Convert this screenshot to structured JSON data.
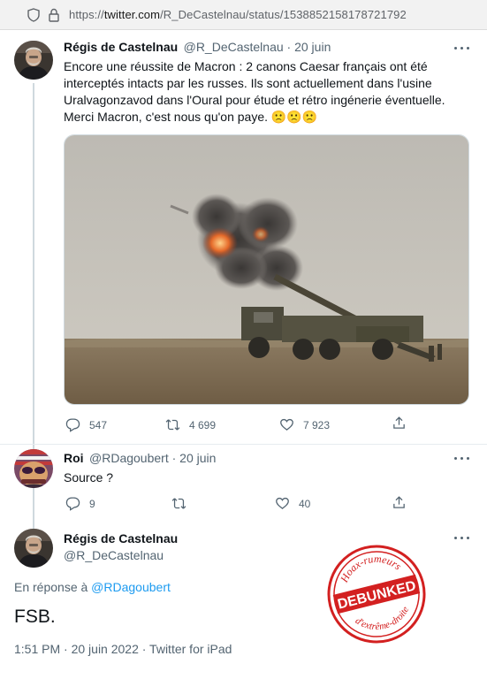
{
  "browser": {
    "url_prefix": "https://",
    "url_host": "twitter.com",
    "url_path": "/R_DeCastelnau/status/1538852158178721792"
  },
  "tweet1": {
    "author_name": "Régis de Castelnau",
    "handle_date": "@R_DeCastelnau · 20 juin",
    "text_line1": "Encore une réussite de Macron : 2 canons Caesar français ont été",
    "text_line2": "interceptés intacts par les russes. Ils sont actuellement dans l'usine",
    "text_line3": "Uralvagonzavod dans l'Oural pour étude et rétro ingénerie éventuelle.",
    "text_line4": "Merci Macron, c'est nous qu'on paye. 🙁🙁🙁",
    "replies": "547",
    "retweets": "4 699",
    "likes": "7 923"
  },
  "reply": {
    "author_name": "Roi",
    "handle_date": "@RDagoubert · 20 juin",
    "text": "Source ?",
    "replies": "9",
    "likes": "40"
  },
  "tweet2": {
    "author_name": "Régis de Castelnau",
    "handle": "@R_DeCastelnau",
    "reply_to_prefix": "En réponse à ",
    "reply_to_handle": "@RDagoubert",
    "text": "FSB.",
    "timestamp": "1:51 PM · 20 juin 2022 · Twitter for iPad"
  },
  "stamp": {
    "top_text": "Hoax-rumeurs",
    "center_text": "DEBUNKED",
    "bottom_text": "d'extrême-droite"
  },
  "colors": {
    "link": "#1d9bf0",
    "secondary_text": "#536471",
    "stamp_red": "#d32020"
  }
}
